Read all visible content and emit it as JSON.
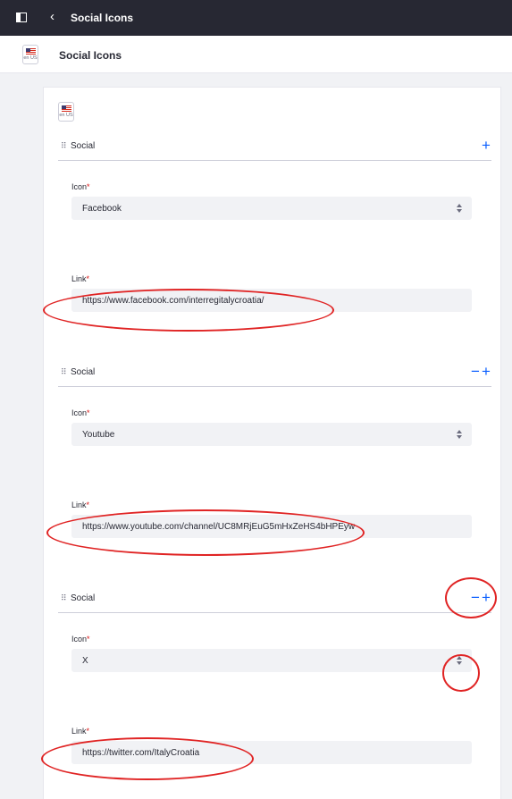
{
  "topbar": {
    "title": "Social Icons"
  },
  "subheader": {
    "title": "Social Icons",
    "locale": "en US"
  },
  "card": {
    "locale": "en US"
  },
  "groups": [
    {
      "title": "Social",
      "icon_label": "Icon",
      "icon_value": "Facebook",
      "link_label": "Link",
      "link_value": "https://www.facebook.com/interregitalycroatia/",
      "actions": [
        "plus"
      ]
    },
    {
      "title": "Social",
      "icon_label": "Icon",
      "icon_value": "Youtube",
      "link_label": "Link",
      "link_value": "https://www.youtube.com/channel/UC8MRjEuG5mHxZeHS4bHPEyw",
      "actions": [
        "minus",
        "plus"
      ]
    },
    {
      "title": "Social",
      "icon_label": "Icon",
      "icon_value": "X",
      "link_label": "Link",
      "link_value": "https://twitter.com/ItalyCroatia",
      "actions": [
        "minus",
        "plus"
      ]
    }
  ],
  "required_mark": "*",
  "colors": {
    "topbar": "#272833",
    "accent": "#0b5fff",
    "required": "#da1414",
    "annotation": "#e02424"
  }
}
